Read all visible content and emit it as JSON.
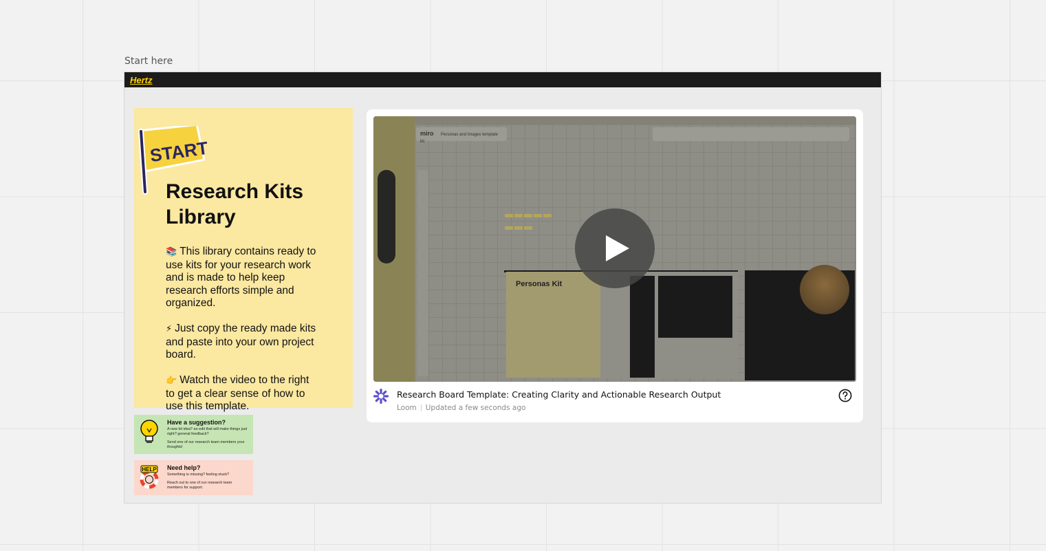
{
  "frame": {
    "label": "Start here",
    "brand": "Hertz"
  },
  "intro": {
    "badge": "START",
    "title_line1": "Research Kits",
    "title_line2": "Library",
    "paragraphs": [
      {
        "emoji": "📚",
        "text": "This library contains ready to use kits for your research work and is made to help keep research efforts simple and organized."
      },
      {
        "emoji": "⚡",
        "text": "Just copy the ready made kits and paste into your own project board."
      },
      {
        "emoji": "👉",
        "text": "Watch the video to the right to get a clear sense of how to use this template."
      }
    ]
  },
  "suggestion": {
    "title": "Have a suggestion?",
    "text1": "A new kit idea? an edit that will make things just right? general feedback?",
    "text2": "Send one of our research team members your thoughts!",
    "icon": "lightbulb-icon",
    "color": "#c6e5b4"
  },
  "help": {
    "title": "Need help?",
    "text1": "Something is missing? feeling stuck?",
    "text2": "Reach out to one of our research team members for support.",
    "icon": "help-lifebuoy-icon",
    "color": "#fcd7cb"
  },
  "video": {
    "title": "Research Board Template: Creating Clarity and Actionable Research Output",
    "source": "Loom",
    "updated": "Updated a few seconds ago",
    "preview_app": "miro",
    "preview_board": "Personas and Images template kit",
    "preview_kit": "Personas Kit"
  },
  "colors": {
    "accent_yellow": "#fbe8a1",
    "brand_yellow": "#ffd400",
    "loom_purple": "#5b4fcf"
  }
}
